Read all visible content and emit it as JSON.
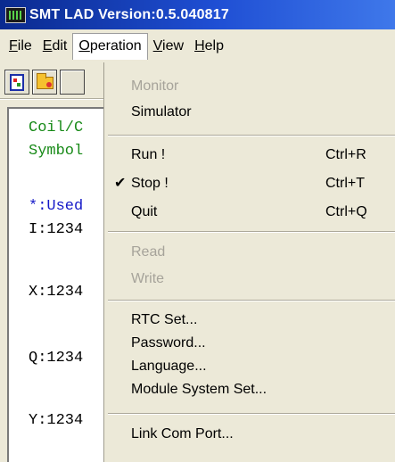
{
  "window": {
    "title": "SMT LAD Version:0.5.040817",
    "icon": "app-icon"
  },
  "menubar": {
    "items": [
      {
        "label": "File",
        "underline": "F",
        "rest": "ile"
      },
      {
        "label": "Edit",
        "underline": "E",
        "rest": "dit"
      },
      {
        "label": "Operation",
        "underline": "O",
        "rest": "peration",
        "active": true
      },
      {
        "label": "View",
        "underline": "V",
        "rest": "iew"
      },
      {
        "label": "Help",
        "underline": "H",
        "rest": "elp"
      }
    ]
  },
  "toolbar": {
    "buttons": [
      {
        "icon": "new-document-icon"
      },
      {
        "icon": "open-folder-icon"
      },
      {
        "icon": "toolbar-icon"
      }
    ]
  },
  "pane": {
    "lines": [
      {
        "text": "Coil/C",
        "color": "#188a18"
      },
      {
        "text": "Symbol",
        "color": "#188a18"
      },
      {
        "text": "*:Used",
        "color": "#1418c8"
      },
      {
        "text": "I:1234",
        "color": "#000000"
      },
      {
        "text": "X:1234",
        "color": "#000000"
      },
      {
        "text": "Q:1234",
        "color": "#000000"
      },
      {
        "text": "Y:1234",
        "color": "#000000"
      }
    ]
  },
  "dropdown": {
    "monitor": {
      "label": "Monitor",
      "enabled": false
    },
    "simulator": {
      "label": "Simulator",
      "enabled": true
    },
    "run": {
      "label": "Run !",
      "shortcut": "Ctrl+R"
    },
    "stop": {
      "label": "Stop !",
      "shortcut": "Ctrl+T",
      "checked": true,
      "check_glyph": "✔"
    },
    "quit": {
      "label": "Quit",
      "shortcut": "Ctrl+Q"
    },
    "read": {
      "label": "Read",
      "enabled": false
    },
    "write": {
      "label": "Write",
      "enabled": false
    },
    "rtc_set": {
      "label": "RTC Set..."
    },
    "password": {
      "label": "Password..."
    },
    "language": {
      "label": "Language..."
    },
    "module_system_set": {
      "label": "Module System Set..."
    },
    "link_com_port": {
      "label": "Link Com Port..."
    }
  },
  "colors": {
    "titlebar_start": "#0a2a8f",
    "titlebar_end": "#3f78ea",
    "menu_bg": "#ece9d8",
    "disabled_text": "#a6a39a"
  }
}
